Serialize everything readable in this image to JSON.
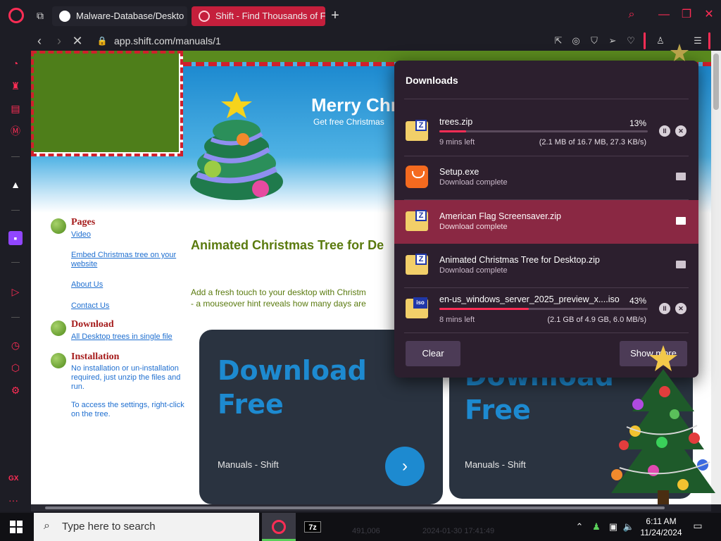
{
  "browser": {
    "tabs": [
      {
        "label": "Malware-Database/Deskto"
      },
      {
        "label": "Shift - Find Thousands of F"
      }
    ],
    "url": "app.shift.com/manuals/1",
    "icons": {
      "logo": "opera-gx-icon",
      "tab_manager": "tab-manager-icon",
      "new_tab": "plus-icon",
      "search": "search-icon",
      "minimize": "minimize-icon",
      "maximize": "maximize-icon",
      "close": "close-icon",
      "back": "back-icon",
      "forward": "forward-icon",
      "reload": "stop-icon",
      "lock": "lock-icon",
      "download": "download-icon"
    },
    "accent_color": "#ff2d55"
  },
  "page": {
    "banner_title": "Merry Chr",
    "banner_subtitle": "Get free Christmas",
    "nav": {
      "pages_heading": "Pages",
      "pages_links": [
        "Video",
        "Embed Christmas tree on your website",
        "About Us",
        "Contact Us"
      ],
      "download_heading": "Download",
      "download_link": "All Desktop trees in single file",
      "install_heading": "Installation",
      "install_text_1": "No installation or un-installation required, just unzip the files and run.",
      "install_text_2": "To access the settings, right-click on the tree."
    },
    "main_heading": "Animated Christmas Tree for De",
    "main_text_1": "Add a fresh touch to your desktop with Christm",
    "main_text_2": "- a mouseover hint reveals how many days are",
    "cards": [
      {
        "title_1": "Download",
        "title_2": "Free",
        "subtitle": "Manuals - Shift"
      },
      {
        "title_1": "Download",
        "title_2": "Free",
        "subtitle": "Manuals - Shift"
      }
    ]
  },
  "downloads": {
    "title": "Downloads",
    "items": [
      {
        "name": "trees.zip",
        "percent": "13%",
        "progress": 0.13,
        "eta": "9 mins left",
        "size": "(2.1 MB of 16.7 MB, 27.3 KB/s)",
        "icon": "zip-file-icon"
      },
      {
        "name": "Setup.exe",
        "status": "Download complete",
        "icon": "exe-installer-icon"
      },
      {
        "name": "American Flag Screensaver.zip",
        "status": "Download complete",
        "icon": "zip-file-icon"
      },
      {
        "name": "Animated Christmas Tree for Desktop.zip",
        "status": "Download complete",
        "icon": "zip-file-icon"
      },
      {
        "name": "en-us_windows_server_2025_preview_x....iso",
        "percent": "43%",
        "progress": 0.43,
        "eta": "8 mins left",
        "size": "(2.1 GB of 4.9 GB, 6.0 MB/s)",
        "icon": "iso-file-icon"
      }
    ],
    "clear_label": "Clear",
    "show_more_label": "Show more",
    "zip_tag": "Z",
    "iso_tag": "iso"
  },
  "taskbar": {
    "search_placeholder": "Type here to search",
    "seven_zip": "7z",
    "ghost_text_1": "491,006",
    "ghost_text_2": "2024-01-30 17:41:49",
    "time": "6:11 AM",
    "date": "11/24/2024"
  },
  "sidebar": {
    "gx_label": "GX",
    "more_label": "···"
  }
}
